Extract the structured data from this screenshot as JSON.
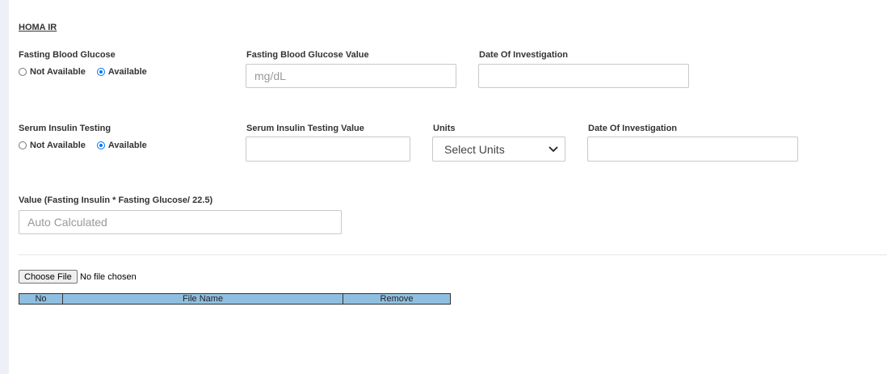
{
  "section": {
    "title": "HOMA IR"
  },
  "fasting_glucose": {
    "label": "Fasting Blood Glucose",
    "options": [
      "Not Available",
      "Available"
    ],
    "selected": "Available",
    "value_label": "Fasting Blood Glucose Value",
    "value_placeholder": "mg/dL",
    "date_label": "Date Of Investigation",
    "date_value": ""
  },
  "serum_insulin": {
    "label": "Serum Insulin Testing",
    "options": [
      "Not Available",
      "Available"
    ],
    "selected": "Available",
    "value_label": "Serum Insulin Testing Value",
    "value_value": "",
    "units_label": "Units",
    "units_selected": "Select Units",
    "date_label": "Date Of Investigation",
    "date_value": ""
  },
  "calculated": {
    "label": "Value (Fasting Insulin * Fasting Glucose/ 22.5)",
    "placeholder": "Auto Calculated"
  },
  "file_upload": {
    "button_label": "Choose File",
    "status": "No file chosen"
  },
  "files_table": {
    "columns": [
      "No",
      "File Name",
      "Remove"
    ]
  },
  "colors": {
    "table_header_bg": "#8fbfe0",
    "radio_accent": "#0075ff"
  },
  "icons": {
    "units_dropdown": "chevron-down-icon"
  }
}
